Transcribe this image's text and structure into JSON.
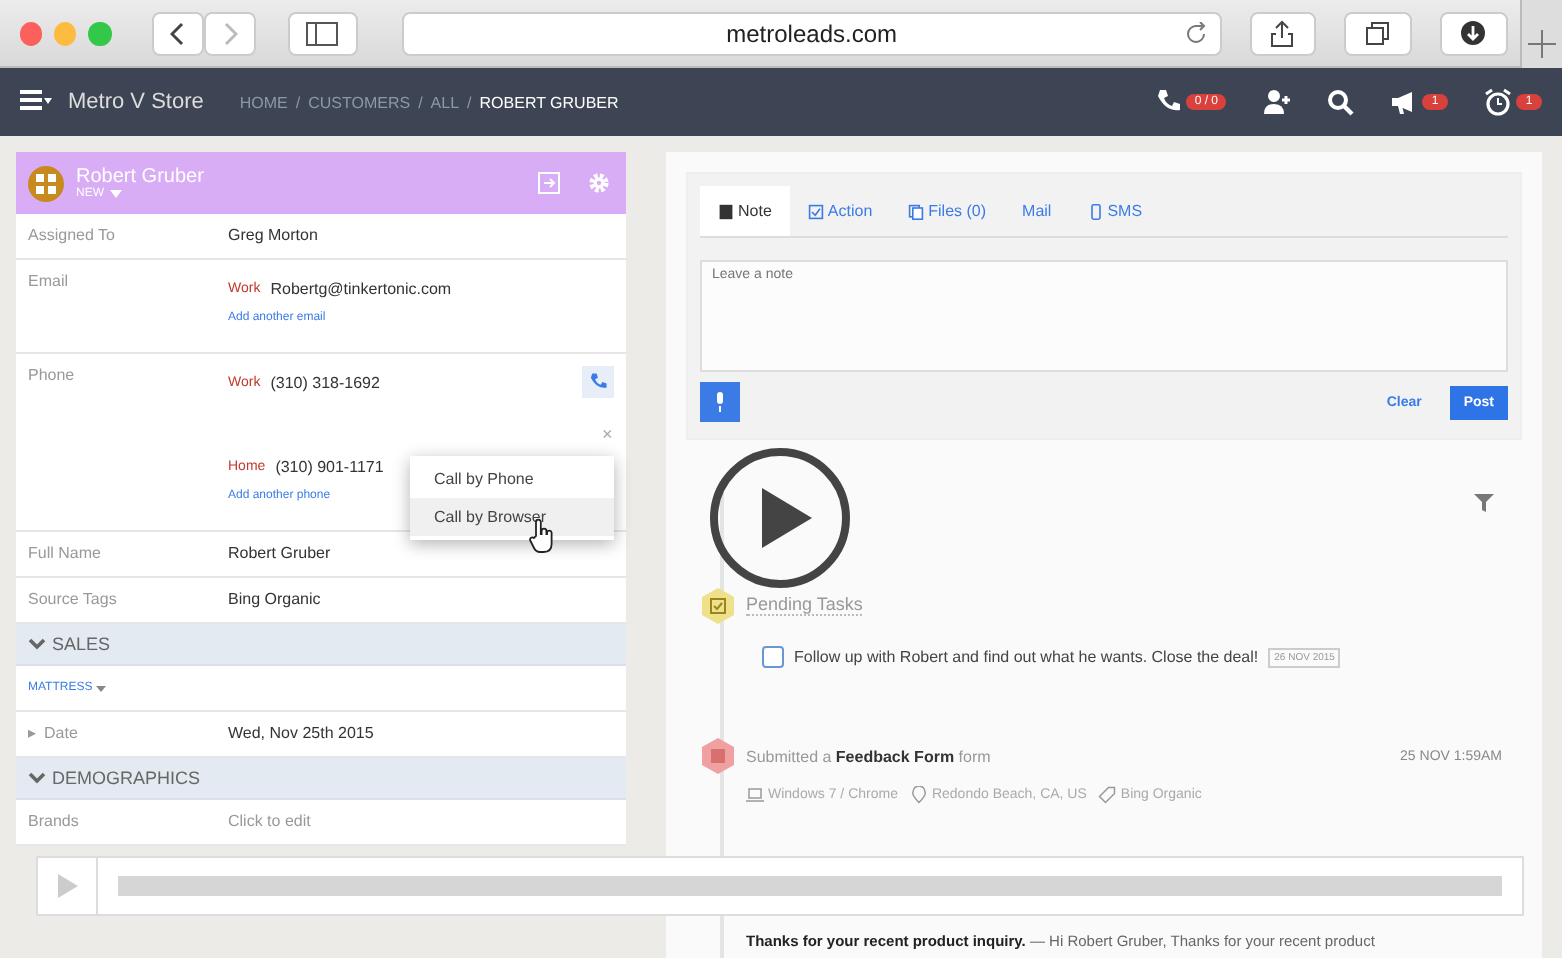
{
  "browser": {
    "url": "metroleads.com"
  },
  "navbar": {
    "store": "Metro V Store",
    "separator": "/",
    "breadcrumbs": [
      "HOME",
      "CUSTOMERS",
      "ALL",
      "ROBERT GRUBER"
    ],
    "icons": [
      {
        "kind": "phone",
        "badge": "0 / 0"
      },
      {
        "kind": "person"
      },
      {
        "kind": "search"
      },
      {
        "kind": "megaphone",
        "badge": "1"
      },
      {
        "kind": "alarm",
        "badge": "1"
      }
    ]
  },
  "contact": {
    "name": "Robert Gruber",
    "status": "NEW",
    "rows": [
      {
        "kind": "field",
        "label": "Assigned To",
        "value": "Greg Morton"
      },
      {
        "kind": "contacts",
        "label": "Email",
        "entries": [
          {
            "type": "Work",
            "value": "Robertg@tinkertonic.com"
          }
        ],
        "add": "Add another email"
      },
      {
        "kind": "contacts",
        "label": "Phone",
        "entries": [
          {
            "type": "Work",
            "value": "(310) 318-1692"
          },
          {
            "type": "Home",
            "value": "(310) 901-1171"
          }
        ],
        "add": "Add another phone",
        "call": true
      },
      {
        "kind": "field",
        "label": "Full Name",
        "value": "Robert Gruber"
      },
      {
        "kind": "field",
        "label": "Source Tags",
        "value": "Bing Organic"
      },
      {
        "kind": "section",
        "title": "SALES"
      },
      {
        "kind": "tag",
        "value": "MATTRESS"
      },
      {
        "kind": "field",
        "label": "Date",
        "value": "Wed, Nov 25th 2015",
        "bullet": "▸"
      },
      {
        "kind": "section",
        "title": "DEMOGRAPHICS"
      },
      {
        "kind": "field",
        "label": "Brands",
        "placeholder": "Click to edit"
      }
    ],
    "call_menu": {
      "close": "×",
      "items": [
        {
          "label": "Call by Phone",
          "selected": false
        },
        {
          "label": "Call by Browser",
          "selected": true
        }
      ]
    }
  },
  "composer": {
    "tabs": [
      {
        "kind": "note",
        "label": "Note",
        "selected": true
      },
      {
        "kind": "action",
        "label": "Action",
        "selected": false
      },
      {
        "kind": "files",
        "label": "Files (0)",
        "selected": false
      },
      {
        "kind": "mail",
        "label": "Mail",
        "selected": false
      },
      {
        "kind": "sms",
        "label": "SMS",
        "selected": false
      }
    ],
    "placeholder": "Leave a note",
    "clear": "Clear",
    "post": "Post"
  },
  "timeline": [
    {
      "kind": "tasks",
      "title": "Pending Tasks",
      "tasks": [
        {
          "text": "Follow up with Robert and find out what he wants.  Close the deal!",
          "due": "26 NOV 2015",
          "checked": false
        }
      ]
    },
    {
      "kind": "form",
      "text": "Submitted a **Feedback Form** form",
      "time": "25 NOV 1:59AM",
      "meta": [
        {
          "kind": "device",
          "text": "Windows 7 / Chrome"
        },
        {
          "kind": "location",
          "text": "Redondo Beach, CA, US"
        },
        {
          "kind": "tag",
          "text": "Bing Organic"
        }
      ]
    },
    {
      "kind": "email",
      "text": "**Thanks for your recent product inquiry.** — Hi Robert Gruber, Thanks for your recent product"
    }
  ],
  "video": {
    "progress": {
      "level": 0
    }
  }
}
